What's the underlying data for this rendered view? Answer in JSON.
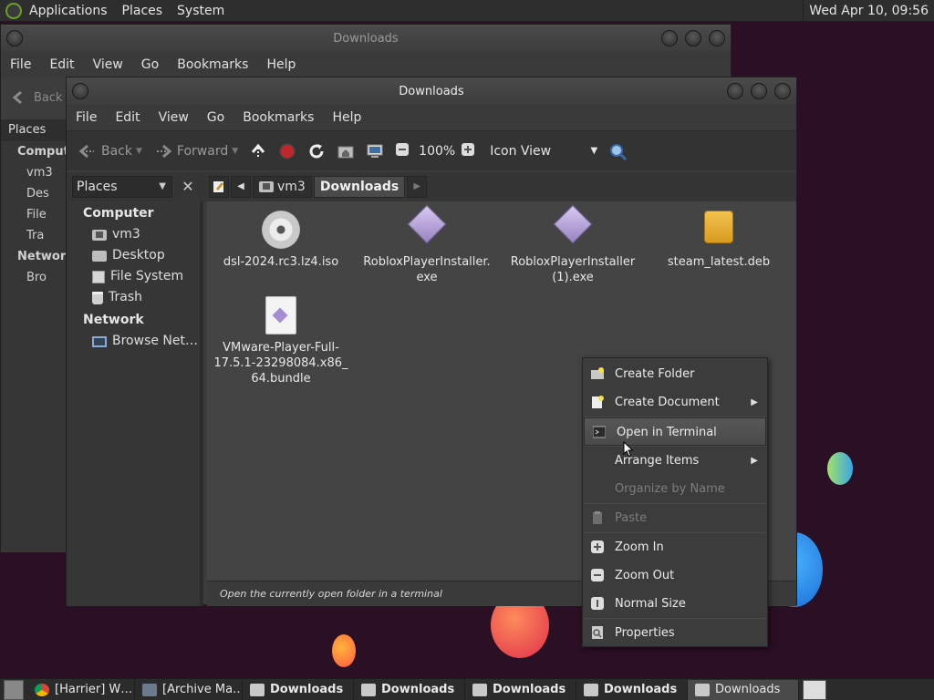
{
  "top_panel": {
    "menu": [
      "Applications",
      "Places",
      "System"
    ],
    "clock": "Wed Apr 10, 09:56"
  },
  "back_window": {
    "title": "Downloads",
    "menu": [
      "File",
      "Edit",
      "View",
      "Go",
      "Bookmarks",
      "Help"
    ],
    "back_label": "Back",
    "places_header": "Places",
    "sidebar": [
      "Compute",
      "vm3",
      "Des",
      "File",
      "Tra",
      "Network",
      "Bro"
    ]
  },
  "window": {
    "title": "Downloads",
    "menu": [
      "File",
      "Edit",
      "View",
      "Go",
      "Bookmarks",
      "Help"
    ],
    "toolbar": {
      "back": "Back",
      "forward": "Forward",
      "zoom": "100%",
      "view_mode": "Icon View"
    },
    "places_combo": "Places",
    "close_symbol": "✕",
    "breadcrumbs": [
      "vm3",
      "Downloads"
    ],
    "sidebar": {
      "computer_header": "Computer",
      "items": [
        "vm3",
        "Desktop",
        "File System",
        "Trash"
      ],
      "network_header": "Network",
      "network_items": [
        "Browse Net…"
      ]
    },
    "files": [
      {
        "name": "dsl-2024.rc3.lz4.iso",
        "icon": "disc-icon"
      },
      {
        "name": "RobloxPlayerInstaller.\nexe",
        "icon": "exe-icon"
      },
      {
        "name": "RobloxPlayerInstaller\n(1).exe",
        "icon": "exe-icon"
      },
      {
        "name": "steam_latest.deb",
        "icon": "package-icon"
      },
      {
        "name": "VMware-Player-Full-\n17.5.1-23298084.x86_\n64.bundle",
        "icon": "document-icon"
      }
    ],
    "status": "Open the currently open folder in a terminal"
  },
  "context_menu": {
    "create_folder": "Create Folder",
    "create_document": "Create Document",
    "open_terminal": "Open in Terminal",
    "arrange_items": "Arrange Items",
    "organize_by_name": "Organize by Name",
    "paste": "Paste",
    "zoom_in": "Zoom In",
    "zoom_out": "Zoom Out",
    "normal_size": "Normal Size",
    "properties": "Properties"
  },
  "taskbar": [
    "[Harrier] W…",
    "[Archive Ma…",
    "Downloads",
    "Downloads",
    "Downloads",
    "Downloads",
    "Downloads"
  ]
}
